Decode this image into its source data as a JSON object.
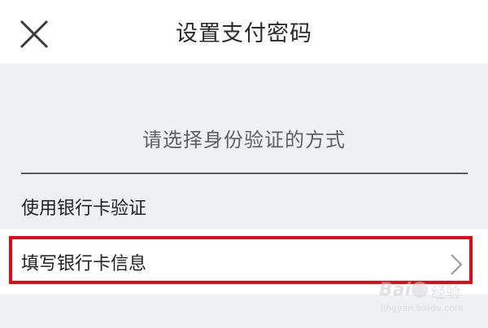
{
  "header": {
    "title": "设置支付密码",
    "close_icon": "close-icon"
  },
  "verification": {
    "prompt": "请选择身份验证的方式",
    "options": [
      {
        "label": "使用银行卡验证"
      },
      {
        "label": "填写银行卡信息",
        "icon": "chevron-right-icon"
      }
    ]
  },
  "watermark": {
    "logo": "Bai",
    "suffix": "经验",
    "url": "jingyan.baidu.com"
  },
  "colors": {
    "highlight": "#e30b12",
    "background": "#eef1f4",
    "surface": "#ffffff"
  }
}
